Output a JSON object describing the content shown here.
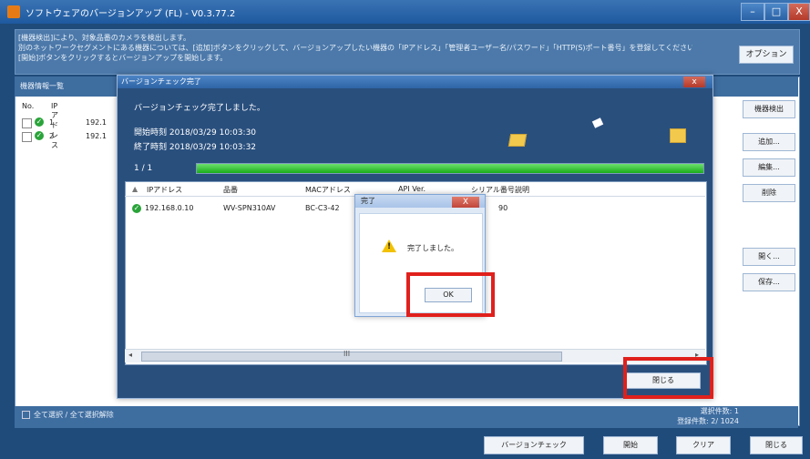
{
  "window": {
    "title": "ソフトウェアのバージョンアップ (FL) - V0.3.77.2",
    "controls": {
      "minimize": "–",
      "maximize": "□",
      "close": "X"
    }
  },
  "header": {
    "notice_lines": [
      "[機器検出]により、対象品番のカメラを検出します。",
      "別のネットワークセグメントにある機器については、[追加]ボタンをクリックして、バージョンアップしたい機器の「IPアドレス」「管理者ユーザー名/パスワード」「HTTP(S)ポート番号」を登録してください。",
      "[開始]ボタンをクリックするとバージョンアップを開始します。"
    ],
    "options_label": "オプション"
  },
  "device_panel": {
    "heading": "機器情報一覧",
    "columns": {
      "no": "No.",
      "ip": "IPアドレス"
    },
    "rows": [
      {
        "no": "1",
        "ip": "192.1"
      },
      {
        "no": "2",
        "ip": "192.1"
      }
    ],
    "side_buttons": {
      "detect": "機器検出",
      "add": "追加...",
      "edit": "編集...",
      "delete": "削除",
      "open": "開く...",
      "save": "保存..."
    },
    "select_all": "全て選択 / 全て選択解除",
    "selected_count": "選択件数: 1",
    "registered_count": "登録件数: 2/ 1024"
  },
  "bottom_buttons": {
    "version_check": "バージョンチェック",
    "start": "開始",
    "clear": "クリア",
    "close": "閉じる"
  },
  "dialog": {
    "title": "バージョンチェック完了",
    "close_x": "x",
    "message": "バージョンチェック完了しました。",
    "start_time": "開始時刻 2018/03/29 10:03:30",
    "end_time": "終了時刻 2018/03/29 10:03:32",
    "progress_text": "1 / 1",
    "progress_fraction": 1.0,
    "list_columns": {
      "ip": "IPアドレス",
      "model": "品番",
      "mac": "MACアドレス",
      "api": "API Ver.",
      "serial": "シリアル番号",
      "desc": "説明"
    },
    "list_rows": [
      {
        "ip": "192.168.0.10",
        "model": "WV-SPN310AV",
        "mac": "BC-C3-42",
        "api": "",
        "serial": "90",
        "desc": ""
      }
    ],
    "scroll_dots": "III",
    "close_button": "閉じる"
  },
  "modal": {
    "title": "完了",
    "close_x": "X",
    "message": "完了しました。",
    "ok_button": "OK"
  },
  "colors": {
    "window_bg": "#1f4b7a",
    "dialog_bg": "#294f7d",
    "progress": "#1aae1a",
    "highlight": "#e0201c"
  }
}
